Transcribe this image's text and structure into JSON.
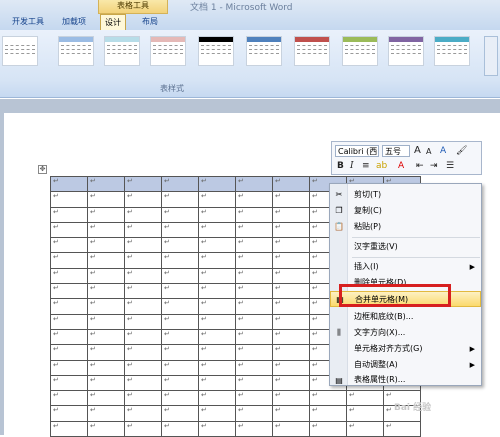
{
  "window": {
    "title": "文档 1 - Microsoft Word",
    "context_group": "表格工具"
  },
  "tabs": [
    {
      "label": "开发工具"
    },
    {
      "label": "加载项"
    },
    {
      "label": "设计"
    },
    {
      "label": "布局"
    }
  ],
  "ribbon": {
    "group_label": "表样式"
  },
  "mini_toolbar": {
    "font": "Calibri (西",
    "size": "五号",
    "grow": "A",
    "shrink": "A",
    "bold": "B",
    "italic": "I"
  },
  "context_menu": {
    "items": [
      {
        "label": "剪切(T)"
      },
      {
        "label": "复制(C)"
      },
      {
        "label": "粘贴(P)"
      },
      {
        "label": "汉字重选(V)"
      },
      {
        "label": "插入(I)"
      },
      {
        "label": "删除单元格(D)..."
      },
      {
        "label": "合并单元格(M)"
      },
      {
        "label": "边框和底纹(B)..."
      },
      {
        "label": "文字方向(X)..."
      },
      {
        "label": "单元格对齐方式(G)"
      },
      {
        "label": "自动调整(A)"
      },
      {
        "label": "表格属性(R)..."
      }
    ]
  },
  "table": {
    "cell_mark": "↵"
  },
  "watermark": "Bai 经验"
}
